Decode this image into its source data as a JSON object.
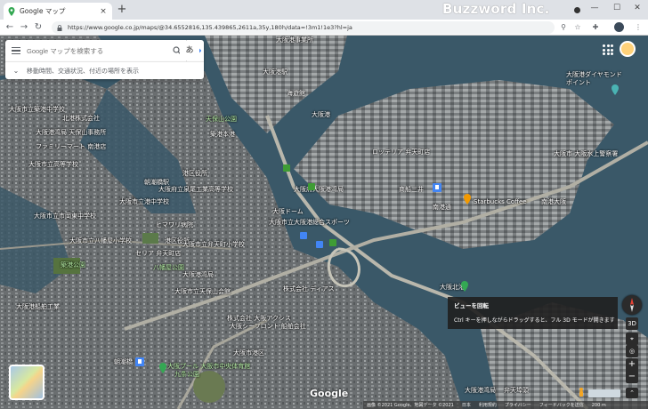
{
  "browser": {
    "tab_title": "Google マップ",
    "new_tab": "+",
    "tab_close": "×",
    "url": "https://www.google.co.jp/maps/@34.6552816,135.439865,2611a,35y,180h/data=!3m1!1e3?hl=ja",
    "watermark": "Buzzword Inc.",
    "win_min": "—",
    "win_max": "☐",
    "win_close": "✕"
  },
  "search": {
    "placeholder": "Google マップを検索する",
    "lang_button": "あ",
    "suggestion": "移動時間、交通状況、付近の場所を表示"
  },
  "map_labels": [
    {
      "text": "大阪港事業所",
      "cls": ""
    },
    {
      "text": "大阪港駅",
      "cls": ""
    },
    {
      "text": "海遊館",
      "cls": ""
    },
    {
      "text": "大阪港",
      "cls": ""
    },
    {
      "text": "大阪港ダイヤモンド\nポイント",
      "cls": ""
    },
    {
      "text": "大阪市 大阪水上警察署",
      "cls": ""
    },
    {
      "text": "天保山公園",
      "cls": "g"
    },
    {
      "text": "北港株式会社",
      "cls": ""
    },
    {
      "text": "築港本港",
      "cls": ""
    },
    {
      "text": "ファミリーマート 南港店",
      "cls": ""
    },
    {
      "text": "大阪港湾局 天保山事務所",
      "cls": ""
    },
    {
      "text": "大阪市立高等学校",
      "cls": ""
    },
    {
      "text": "大阪市立市岡東中学校",
      "cls": ""
    },
    {
      "text": "大阪府立泉尾工業高等学校",
      "cls": ""
    },
    {
      "text": "ヒマワリ病院",
      "cls": ""
    },
    {
      "text": "港区役所",
      "cls": ""
    },
    {
      "text": "大阪市立港中学校",
      "cls": ""
    },
    {
      "text": "築港公園",
      "cls": "g"
    },
    {
      "text": "大阪港船舶工業",
      "cls": ""
    },
    {
      "text": "大阪市立築港中学校",
      "cls": ""
    },
    {
      "text": "港区役所",
      "cls": ""
    },
    {
      "text": "大阪港湾局",
      "cls": ""
    },
    {
      "text": "八幡屋公園",
      "cls": "g"
    },
    {
      "text": "セリア 弁天町店",
      "cls": ""
    },
    {
      "text": "大阪市立天保山会館",
      "cls": ""
    },
    {
      "text": "株式会社 ディアス",
      "cls": ""
    },
    {
      "text": "大阪ドーム",
      "cls": ""
    },
    {
      "text": "大阪市立大阪港総合スポーツ",
      "cls": ""
    },
    {
      "text": "大阪市立弁天町小学校",
      "cls": ""
    },
    {
      "text": "大阪府大阪港湾局",
      "cls": ""
    },
    {
      "text": "株式会社 大阪アクシス",
      "cls": ""
    },
    {
      "text": "大阪シーフロント 船舶会社",
      "cls": ""
    },
    {
      "text": "朝潮橋",
      "cls": ""
    },
    {
      "text": "大阪市立八幡屋小学校",
      "cls": ""
    },
    {
      "text": "朝潮橋駅",
      "cls": ""
    },
    {
      "text": "大阪プール 大阪市中央体育館",
      "cls": "g"
    },
    {
      "text": "南港大阪",
      "cls": ""
    },
    {
      "text": "ロッテリア 弁天町店",
      "cls": ""
    },
    {
      "text": "Starbucks Coffee",
      "cls": ""
    },
    {
      "text": "商船三井",
      "cls": ""
    },
    {
      "text": "南港通",
      "cls": ""
    },
    {
      "text": "大阪市港区",
      "cls": ""
    },
    {
      "text": "九条公園",
      "cls": "g"
    },
    {
      "text": "弁天埠頭",
      "cls": ""
    },
    {
      "text": "大阪港湾局",
      "cls": ""
    },
    {
      "text": "大阪北港",
      "cls": ""
    }
  ],
  "tooltip": {
    "title": "ビューを回転",
    "body": "Ctrl キーを押しながらドラッグすると、フル 3D モードが開きます"
  },
  "controls": {
    "btn_3d": "3D",
    "zoom_in": "+",
    "zoom_out": "−",
    "expand": "⌃"
  },
  "footer": {
    "google": "Google",
    "attribution": "画像 ©2021 Google、地図データ ©2021",
    "country": "日本",
    "terms": "利用規約",
    "privacy": "プライバシー",
    "feedback": "フィードバックを送信",
    "scale": "200 m"
  },
  "colors": {
    "water": "#3a5868",
    "land": "#5a6064",
    "pin_blue": "#4285f4",
    "pin_green": "#34a853",
    "pin_orange": "#f29900"
  }
}
